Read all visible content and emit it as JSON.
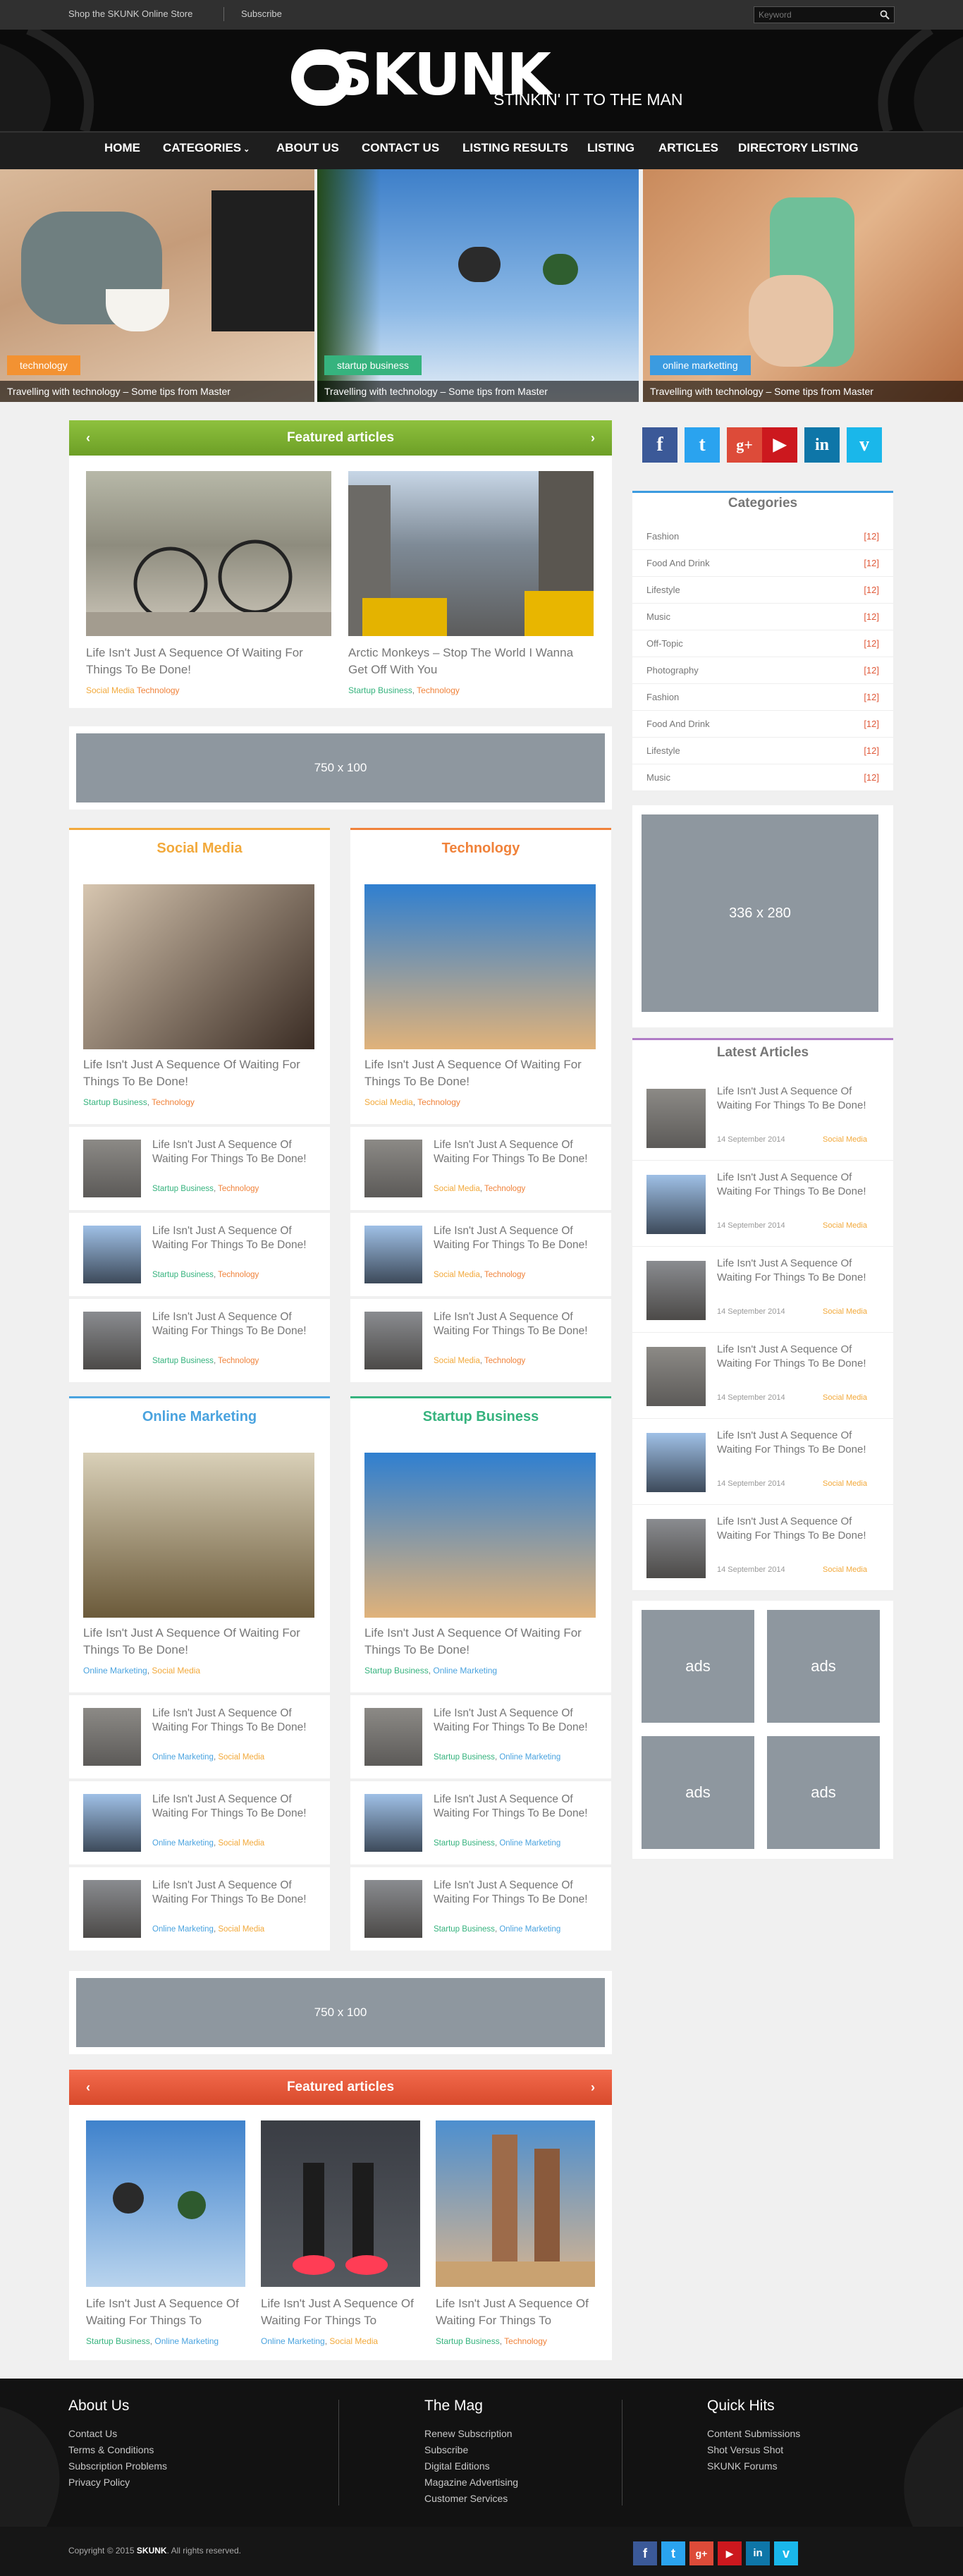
{
  "topbar": {
    "store": "Shop the SKUNK Online Store",
    "subscribe": "Subscribe",
    "search_placeholder": "Keyword"
  },
  "header": {
    "logo": "SKUNK",
    "tagline": "STINKIN' IT TO THE MAN"
  },
  "nav": [
    "HOME",
    "CATEGORIES",
    "ABOUT US",
    "CONTACT US",
    "LISTING RESULTS",
    "LISTING",
    "ARTICLES",
    "DIRECTORY LISTING"
  ],
  "slides": [
    {
      "tag": "technology",
      "caption": "Travelling with technology – Some tips from Master",
      "tag_color": "#f39232"
    },
    {
      "tag": "startup business",
      "caption": "Travelling with technology – Some tips from Master",
      "tag_color": "#36b37e"
    },
    {
      "tag": "online marketting",
      "caption": "Travelling with technology – Some tips from Master",
      "tag_color": "#3b9be0"
    }
  ],
  "featured1": {
    "title": "Featured articles",
    "items": [
      {
        "title": "Life Isn't Just A Sequence Of Waiting For Things To Be Done!",
        "cat1": "Social Media",
        "cat2": "Technology"
      },
      {
        "title": "Arctic Monkeys – Stop The World I Wanna Get Off With You",
        "cat1": "Startup Business",
        "cat2": "Technology"
      }
    ]
  },
  "ad_banner": "750 x 100",
  "ad_banner2": "750 x 100",
  "boxes": [
    {
      "title": "Social Media",
      "color": "#f2a93b",
      "main": {
        "title": "Life Isn't Just A Sequence Of Waiting For Things To Be Done!",
        "cat1": "Startup Business",
        "cat2": "Technology"
      },
      "rows": [
        {
          "title": "Life Isn't Just A Sequence Of Waiting For Things To Be Done!",
          "cat1": "Startup Business",
          "cat2": "Technology"
        },
        {
          "title": "Life Isn't Just A Sequence Of Waiting For Things To Be Done!",
          "cat1": "Startup Business",
          "cat2": "Technology"
        },
        {
          "title": "Life Isn't Just A Sequence Of Waiting For Things To Be Done!",
          "cat1": "Startup Business",
          "cat2": "Technology"
        }
      ]
    },
    {
      "title": "Technology",
      "color": "#f0823a",
      "main": {
        "title": "Life Isn't Just A Sequence Of Waiting For Things To Be Done!",
        "cat1": "Social Media",
        "cat2": "Technology"
      },
      "rows": [
        {
          "title": "Life Isn't Just A Sequence Of Waiting For Things To Be Done!",
          "cat1": "Social Media",
          "cat2": "Technology"
        },
        {
          "title": "Life Isn't Just A Sequence Of Waiting For Things To Be Done!",
          "cat1": "Social Media",
          "cat2": "Technology"
        },
        {
          "title": "Life Isn't Just A Sequence Of Waiting For Things To Be Done!",
          "cat1": "Social Media",
          "cat2": "Technology"
        }
      ]
    },
    {
      "title": "Online Marketing",
      "color": "#4aa3df",
      "main": {
        "title": "Life Isn't Just A Sequence Of Waiting For Things To Be Done!",
        "cat1": "Online Marketing",
        "cat2": "Social Media"
      },
      "rows": [
        {
          "title": "Life Isn't Just A Sequence Of Waiting For Things To Be Done!",
          "cat1": "Online Marketing",
          "cat2": "Social Media"
        },
        {
          "title": "Life Isn't Just A Sequence Of Waiting For Things To Be Done!",
          "cat1": "Online Marketing",
          "cat2": "Social Media"
        },
        {
          "title": "Life Isn't Just A Sequence Of Waiting For Things To Be Done!",
          "cat1": "Online Marketing",
          "cat2": "Social Media"
        }
      ]
    },
    {
      "title": "Startup Business",
      "color": "#36b37e",
      "main": {
        "title": "Life Isn't Just A Sequence Of Waiting For Things To Be Done!",
        "cat1": "Startup Business",
        "cat2": "Online Marketing"
      },
      "rows": [
        {
          "title": "Life Isn't Just A Sequence Of Waiting For Things To Be Done!",
          "cat1": "Startup Business",
          "cat2": "Online Marketing"
        },
        {
          "title": "Life Isn't Just A Sequence Of Waiting For Things To Be Done!",
          "cat1": "Startup Business",
          "cat2": "Online Marketing"
        },
        {
          "title": "Life Isn't Just A Sequence Of Waiting For Things To Be Done!",
          "cat1": "Startup Business",
          "cat2": "Online Marketing"
        }
      ]
    }
  ],
  "featured2": {
    "title": "Featured articles",
    "items": [
      {
        "title": "Life Isn't Just A Sequence Of Waiting For Things To",
        "cat1": "Startup Business",
        "cat2": "Online Marketing"
      },
      {
        "title": "Life Isn't Just A Sequence Of Waiting For Things To",
        "cat1": "Online Marketing",
        "cat2": "Social Media"
      },
      {
        "title": "Life Isn't Just A Sequence Of Waiting For Things To",
        "cat1": "Startup Business",
        "cat2": "Technology"
      }
    ]
  },
  "sidebar": {
    "social": [
      "f",
      "t",
      "g+",
      "▶",
      "in",
      "v"
    ],
    "categories_title": "Categories",
    "categories": [
      {
        "name": "Fashion",
        "count": "[12]"
      },
      {
        "name": "Food And Drink",
        "count": "[12]"
      },
      {
        "name": "Lifestyle",
        "count": "[12]"
      },
      {
        "name": "Music",
        "count": "[12]"
      },
      {
        "name": "Off-Topic",
        "count": "[12]"
      },
      {
        "name": "Photography",
        "count": "[12]"
      },
      {
        "name": "Fashion",
        "count": "[12]"
      },
      {
        "name": "Food And Drink",
        "count": "[12]"
      },
      {
        "name": "Lifestyle",
        "count": "[12]"
      },
      {
        "name": "Music",
        "count": "[12]"
      }
    ],
    "ad_box": "336 x 280",
    "latest_title": "Latest Articles",
    "latest": [
      {
        "title": "Life Isn't Just A Sequence Of Waiting For Things To Be Done!",
        "date": "14 September 2014",
        "cat": "Social Media"
      },
      {
        "title": "Life Isn't Just A Sequence Of Waiting For Things To Be Done!",
        "date": "14 September 2014",
        "cat": "Social Media"
      },
      {
        "title": "Life Isn't Just A Sequence Of Waiting For Things To Be Done!",
        "date": "14 September 2014",
        "cat": "Social Media"
      },
      {
        "title": "Life Isn't Just A Sequence Of Waiting For Things To Be Done!",
        "date": "14 September 2014",
        "cat": "Social Media"
      },
      {
        "title": "Life Isn't Just A Sequence Of Waiting For Things To Be Done!",
        "date": "14 September 2014",
        "cat": "Social Media"
      },
      {
        "title": "Life Isn't Just A Sequence Of Waiting For Things To Be Done!",
        "date": "14 September 2014",
        "cat": "Social Media"
      }
    ],
    "ads": [
      "ads",
      "ads",
      "ads",
      "ads"
    ]
  },
  "footer": {
    "about_title": "About Us",
    "about_links": [
      "Contact Us",
      "Terms & Conditions",
      "Subscription Problems",
      "Privacy Policy"
    ],
    "mag_title": "The Mag",
    "mag_links": [
      "Renew Subscription",
      "Subscribe",
      "Digital Editions",
      "Magazine Advertising",
      "Customer Services"
    ],
    "hits_title": "Quick Hits",
    "hits_links": [
      "Content Submissions",
      "Shot Versus Shot",
      "SKUNK Forums"
    ],
    "copyright_pre": "Copyright © 2015",
    "copyright_brand": "SKUNK",
    "copyright_post": ". All rights reserved."
  }
}
